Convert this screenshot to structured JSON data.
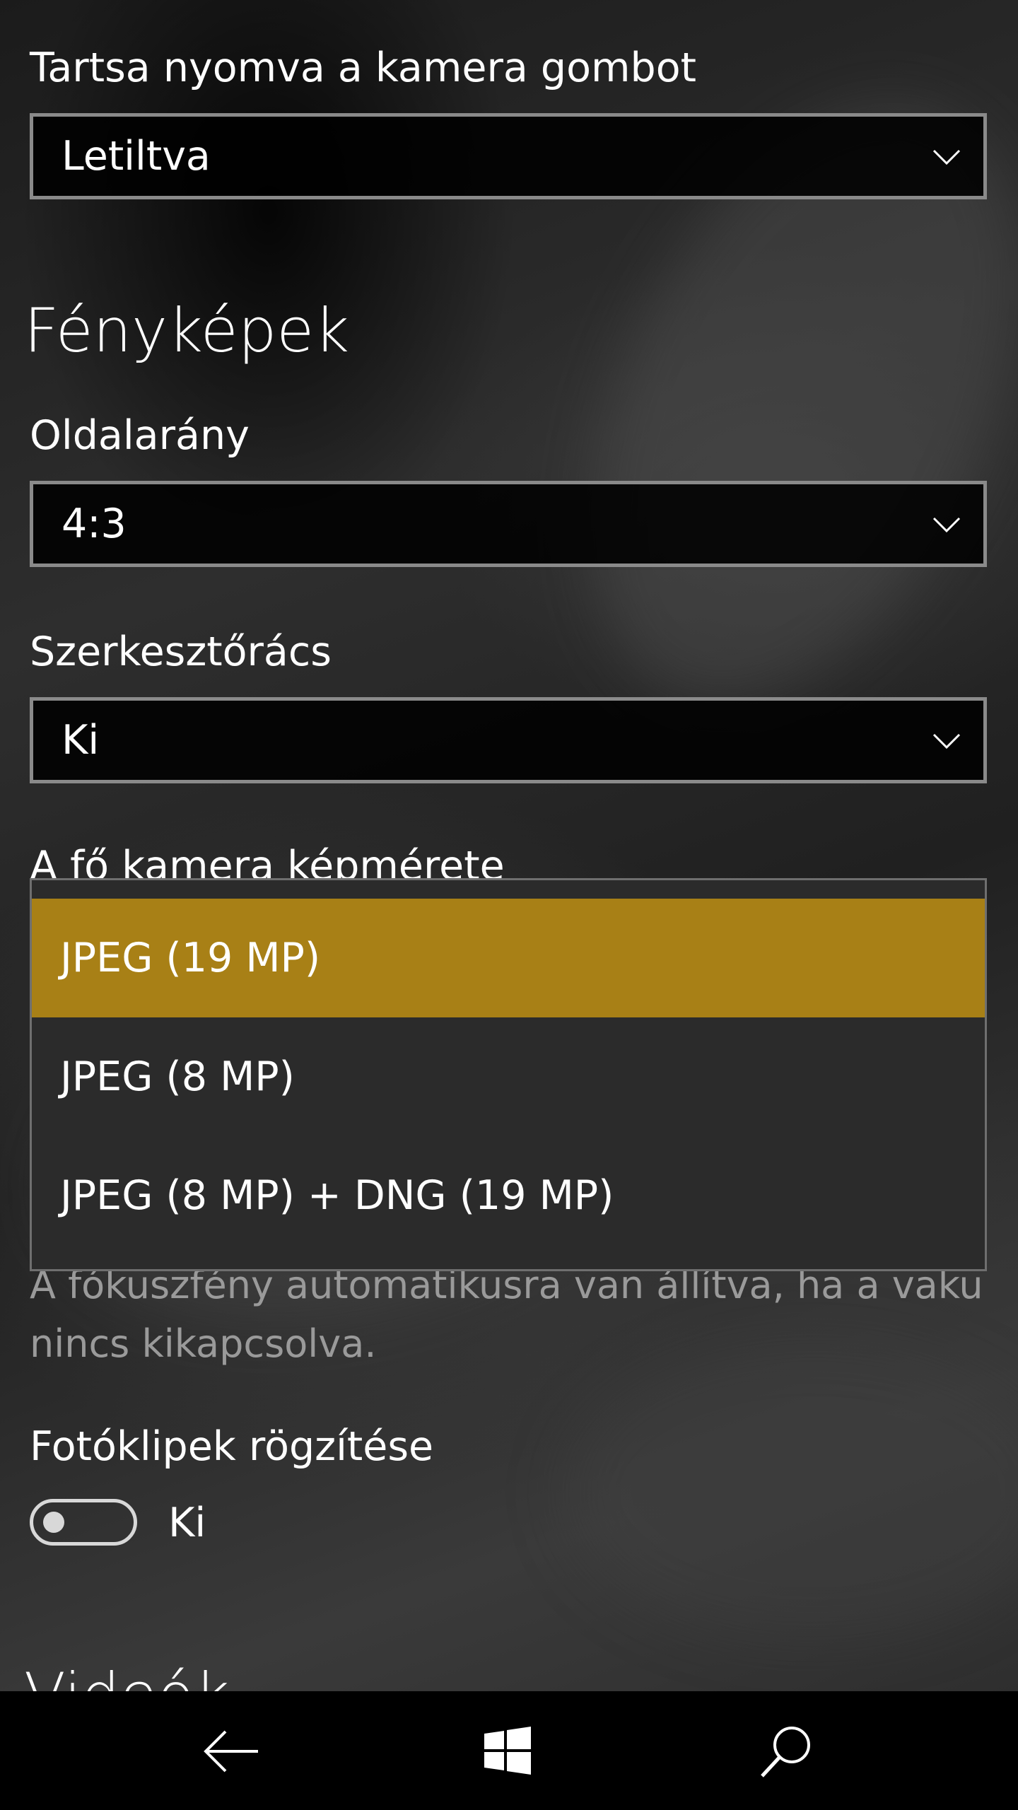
{
  "camera_button": {
    "label": "Tartsa nyomva a kamera gombot",
    "value": "Letiltva"
  },
  "photos_section": {
    "title": "Fényképek"
  },
  "aspect_ratio": {
    "label": "Oldalarány",
    "value": "4:3"
  },
  "framing_grid": {
    "label": "Szerkesztőrács",
    "value": "Ki"
  },
  "main_camera_size": {
    "label": "A fő kamera képmérete",
    "options": [
      {
        "label": "JPEG (19 MP)",
        "selected": true
      },
      {
        "label": "JPEG (8 MP)",
        "selected": false
      },
      {
        "label": "JPEG (8 MP) + DNG (19 MP)",
        "selected": false
      }
    ]
  },
  "focus_light_note": "A fókuszfény automatikusra van állítva, ha a vaku nincs kikapcsolva.",
  "living_images": {
    "label": "Fotóklipek rögzítése",
    "state": "Ki",
    "on": false
  },
  "video_section": {
    "title": "Videók"
  },
  "colors": {
    "accent": "#a88016",
    "flyout_bg": "#2b2b2b",
    "border": "#8a8a8a"
  },
  "navbar": {
    "icons": [
      "back-arrow-icon",
      "windows-logo-icon",
      "search-icon"
    ]
  }
}
